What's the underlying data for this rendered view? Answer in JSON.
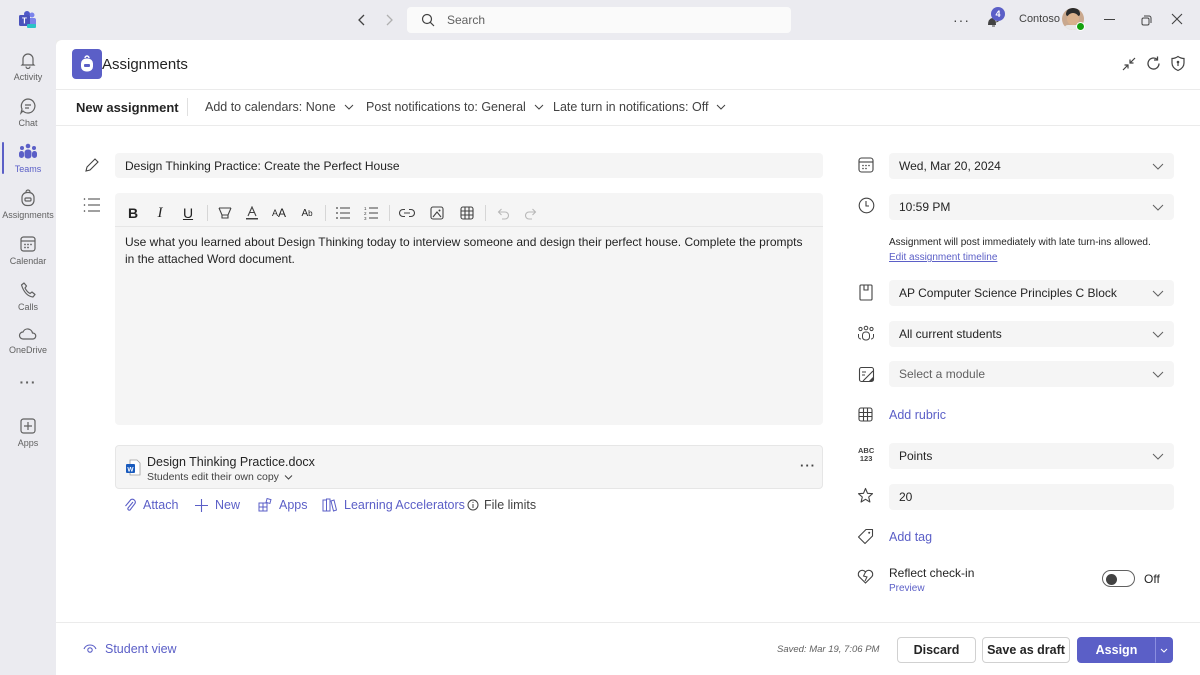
{
  "titlebar": {
    "search_placeholder": "Search",
    "notification_count": "4",
    "org_name": "Contoso"
  },
  "rail": {
    "items": [
      {
        "label": "Activity",
        "icon": "bell-icon"
      },
      {
        "label": "Chat",
        "icon": "chat-icon"
      },
      {
        "label": "Teams",
        "icon": "teams-icon",
        "active": true
      },
      {
        "label": "Assignments",
        "icon": "backpack-icon"
      },
      {
        "label": "Calendar",
        "icon": "calendar-icon"
      },
      {
        "label": "Calls",
        "icon": "phone-icon"
      },
      {
        "label": "OneDrive",
        "icon": "cloud-icon"
      },
      {
        "label": "...",
        "icon": "more-icon"
      },
      {
        "label": "Apps",
        "icon": "add-app-icon"
      }
    ]
  },
  "header": {
    "title": "Assignments"
  },
  "toolbar": {
    "new_assignment": "New assignment",
    "calendars": "Add to calendars: None",
    "notifications": "Post notifications to: General",
    "late_turn_in": "Late turn in notifications: Off"
  },
  "form": {
    "title_value": "Design Thinking Practice: Create the Perfect House",
    "instructions": "Use what you learned about Design Thinking today to interview someone and design their perfect house. Complete the prompts in the attached Word document.",
    "attachment": {
      "name": "Design Thinking Practice.docx",
      "permission": "Students edit their own copy"
    },
    "actions": {
      "attach": "Attach",
      "new": "New",
      "apps": "Apps",
      "learning_accelerators": "Learning Accelerators",
      "file_limits": "File limits"
    }
  },
  "side": {
    "due_date": "Wed, Mar 20, 2024",
    "due_time": "10:59 PM",
    "timeline_note": "Assignment will post immediately with late turn-ins allowed.",
    "edit_timeline": "Edit assignment timeline",
    "class": "AP Computer Science Principles C Block",
    "students": "All current students",
    "module_placeholder": "Select a module",
    "add_rubric": "Add rubric",
    "grading": "Points",
    "points": "20",
    "add_tag": "Add tag",
    "reflect_label": "Reflect check-in",
    "reflect_preview": "Preview",
    "reflect_state": "Off"
  },
  "footer": {
    "student_view": "Student view",
    "saved": "Saved: Mar 19, 7:06 PM",
    "discard": "Discard",
    "save_draft": "Save as draft",
    "assign": "Assign"
  },
  "colors": {
    "brand": "#5b5fc7"
  }
}
